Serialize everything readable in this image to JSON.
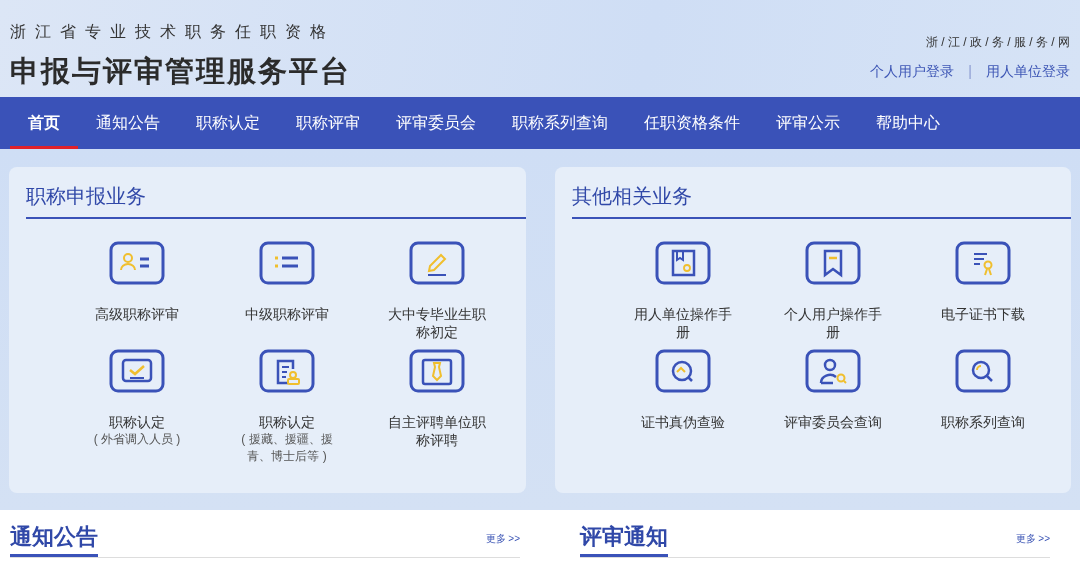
{
  "header": {
    "subtitle": "浙江省专业技术职务任职资格",
    "title": "申报与评审管理服务平台",
    "portal_link": "浙 / 江 / 政 / 务 / 服 / 务 / 网",
    "login_links": [
      "个人用户登录",
      "用人单位登录"
    ],
    "separator": "|"
  },
  "nav": [
    {
      "label": "首页",
      "selected": true
    },
    {
      "label": "通知公告",
      "selected": false
    },
    {
      "label": "职称认定",
      "selected": false
    },
    {
      "label": "职称评审",
      "selected": false
    },
    {
      "label": "评审委员会",
      "selected": false
    },
    {
      "label": "职称系列查询",
      "selected": false
    },
    {
      "label": "任职资格条件",
      "selected": false
    },
    {
      "label": "评审公示",
      "selected": false
    },
    {
      "label": "帮助中心",
      "selected": false
    }
  ],
  "panels": [
    {
      "title": "职称申报业务",
      "items": [
        {
          "label": "高级职称评审"
        },
        {
          "label": "中级职称评审"
        },
        {
          "label": "大中专毕业生职称初定"
        },
        {
          "label": "职称认定",
          "note": "( 外省调入人员 )"
        },
        {
          "label": "职称认定",
          "note": "( 援藏、援疆、援青、博士后等 )"
        },
        {
          "label": "自主评聘单位职称评聘"
        }
      ]
    },
    {
      "title": "其他相关业务",
      "items": [
        {
          "label": "用人单位操作手册"
        },
        {
          "label": "个人用户操作手册"
        },
        {
          "label": "电子证书下载"
        },
        {
          "label": "证书真伪查验"
        },
        {
          "label": "评审委员会查询"
        },
        {
          "label": "职称系列查询"
        }
      ]
    }
  ],
  "sections": [
    {
      "title": "通知公告",
      "more": "更多 >>"
    },
    {
      "title": "评审通知",
      "more": "更多 >>"
    }
  ]
}
